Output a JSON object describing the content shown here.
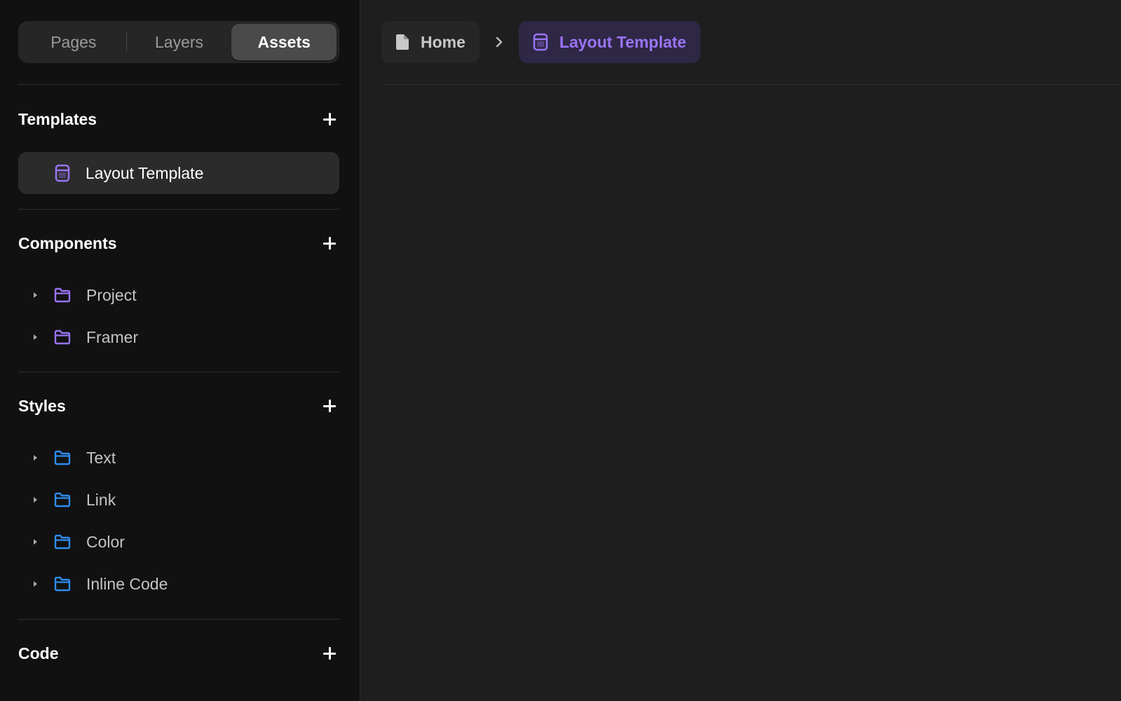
{
  "sidebar": {
    "tabs": [
      {
        "label": "Pages",
        "active": false
      },
      {
        "label": "Layers",
        "active": false
      },
      {
        "label": "Assets",
        "active": true
      }
    ],
    "sections": {
      "templates": {
        "title": "Templates",
        "items": [
          {
            "label": "Layout Template",
            "icon": "template-icon"
          }
        ]
      },
      "components": {
        "title": "Components",
        "items": [
          {
            "label": "Project",
            "icon": "folder-icon"
          },
          {
            "label": "Framer",
            "icon": "folder-icon"
          }
        ]
      },
      "styles": {
        "title": "Styles",
        "items": [
          {
            "label": "Text",
            "icon": "folder-icon"
          },
          {
            "label": "Link",
            "icon": "folder-icon"
          },
          {
            "label": "Color",
            "icon": "folder-icon"
          },
          {
            "label": "Inline Code",
            "icon": "folder-icon"
          }
        ]
      },
      "code": {
        "title": "Code",
        "items": []
      }
    }
  },
  "breadcrumb": {
    "home_label": "Home",
    "current_label": "Layout Template"
  },
  "colors": {
    "accent_purple": "#9a74f4",
    "accent_blue": "#2e8cf0",
    "sidebar_bg": "#111111",
    "canvas_bg": "#1e1e1e"
  }
}
